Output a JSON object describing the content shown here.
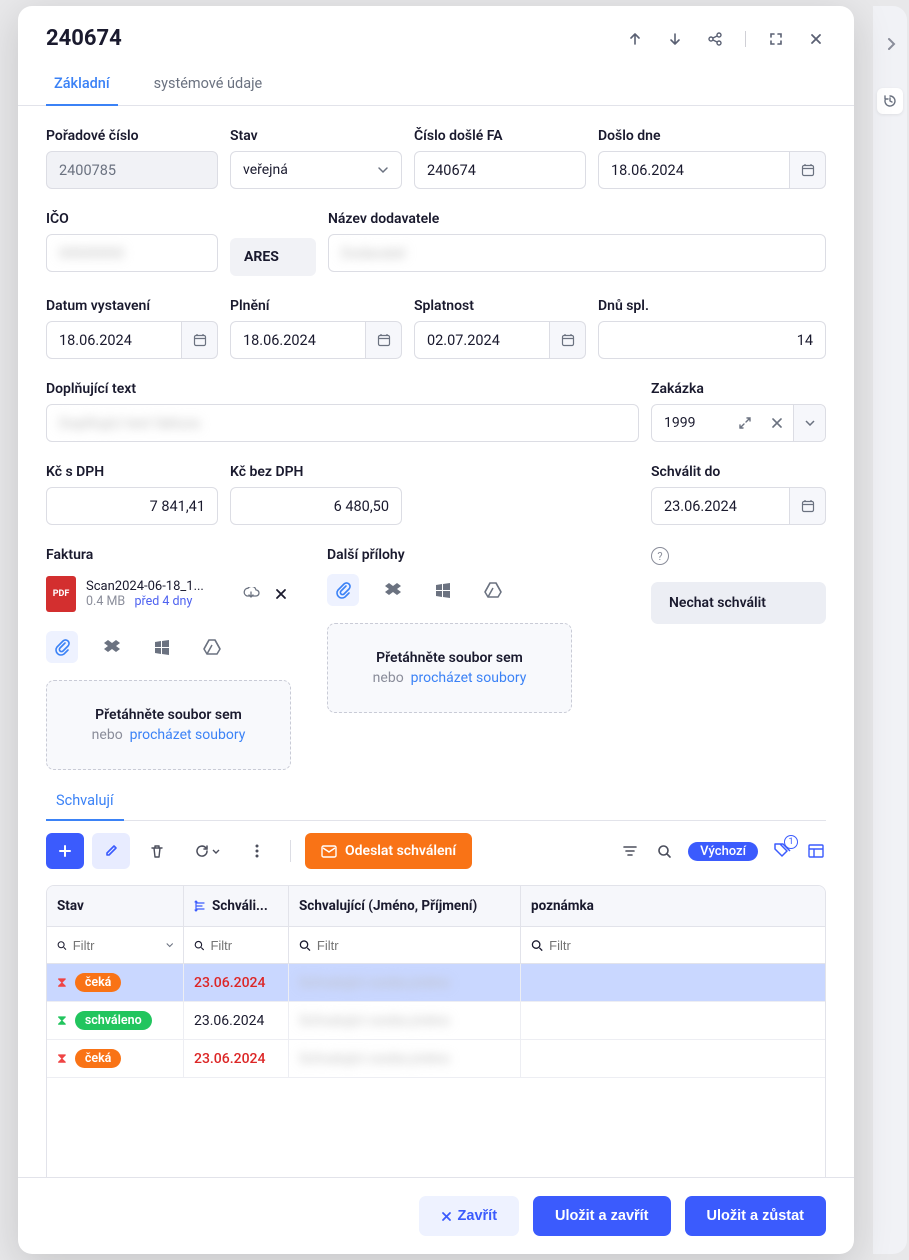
{
  "header": {
    "title": "240674"
  },
  "tabs": {
    "basic": "Základní",
    "system": "systémové údaje"
  },
  "fields": {
    "seq": {
      "label": "Pořadové číslo",
      "value": "2400785"
    },
    "state": {
      "label": "Stav",
      "value": "veřejná"
    },
    "invoiceNo": {
      "label": "Číslo došlé FA",
      "value": "240674"
    },
    "received": {
      "label": "Došlo dne",
      "value": "18.06.2024"
    },
    "ico": {
      "label": "IČO",
      "value": "00000000"
    },
    "aresBtn": "ARES",
    "supplier": {
      "label": "Název dodavatele",
      "value": "Dodavatel"
    },
    "issued": {
      "label": "Datum vystavení",
      "value": "18.06.2024"
    },
    "fulfillment": {
      "label": "Plnění",
      "value": "18.06.2024"
    },
    "due": {
      "label": "Splatnost",
      "value": "02.07.2024"
    },
    "daysDue": {
      "label": "Dnů spl.",
      "value": "14"
    },
    "note": {
      "label": "Doplňující text",
      "value": "Doplňující text faktura"
    },
    "order": {
      "label": "Zakázka",
      "value": "1999"
    },
    "withVat": {
      "label": "Kč s DPH",
      "value": "7 841,41"
    },
    "noVat": {
      "label": "Kč bez DPH",
      "value": "6 480,50"
    },
    "approveBy": {
      "label": "Schválit do",
      "value": "23.06.2024"
    },
    "approveBtn": "Nechat schválit"
  },
  "invoiceSection": {
    "label": "Faktura",
    "file": {
      "name": "Scan2024-06-18_1...",
      "size": "0.4 MB",
      "ago": "před 4 dny"
    },
    "dropTitle": "Přetáhněte soubor sem",
    "dropOr": "nebo",
    "dropBrowse": "procházet soubory"
  },
  "attachSection": {
    "label": "Další přílohy",
    "dropTitle": "Přetáhněte soubor sem",
    "dropOr": "nebo",
    "dropBrowse": "procházet soubory"
  },
  "approvers": {
    "tab": "Schvalují",
    "sendBtn": "Odeslat schválení",
    "viewBadge": "Výchozí",
    "tagCount": "1",
    "columns": {
      "state": "Stav",
      "approveBy": "Schváli...",
      "approver": "Schvalující (Jméno, Příjmení)",
      "note": "poznámka"
    },
    "filterPlaceholder": "Filtr",
    "rows": [
      {
        "status": "čeká",
        "statusType": "wait",
        "date": "23.06.2024",
        "dateRed": true,
        "name": "",
        "selected": true
      },
      {
        "status": "schváleno",
        "statusType": "ok",
        "date": "23.06.2024",
        "dateRed": false,
        "name": "",
        "selected": false
      },
      {
        "status": "čeká",
        "statusType": "wait",
        "date": "23.06.2024",
        "dateRed": true,
        "name": "",
        "selected": false
      }
    ]
  },
  "footer": {
    "close": "Zavřít",
    "saveClose": "Uložit a zavřít",
    "saveStay": "Uložit a zůstat"
  }
}
